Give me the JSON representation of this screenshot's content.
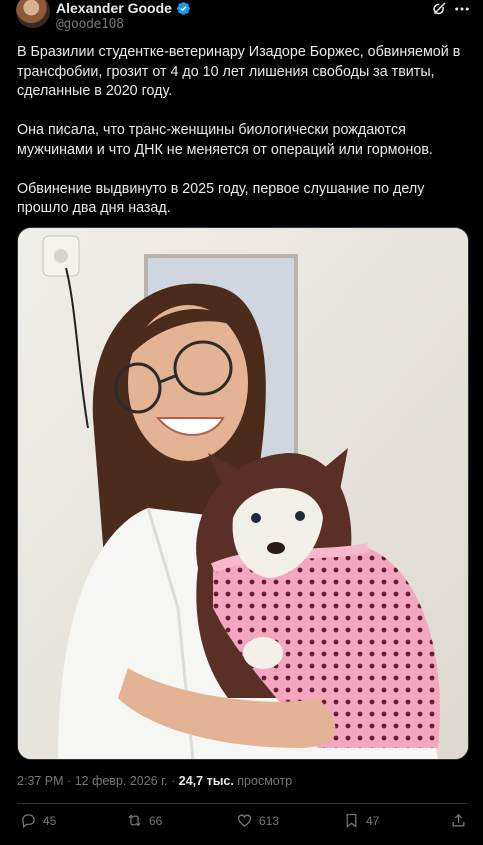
{
  "author": {
    "name": "Alexander Goode",
    "handle": "@goode108"
  },
  "tweet": {
    "paragraphs": [
      "В Бразилии студентке-ветеринару Изадоре Боржес, обвиняемой в трансфобии, грозит от 4 до 10 лет лишения свободы за твиты, сделанные в 2020 году.",
      "Она писала, что транс-женщины биологически рождаются мужчинами и что ДНК не меняется от операций или гормонов.",
      "Обвинение выдвинуто в 2025 году, первое слушание по делу прошло два дня назад."
    ]
  },
  "meta": {
    "time": "2:37 PM",
    "date": "12 февр. 2026 г.",
    "views_count": "24,7 тыс.",
    "views_label": "просмотр"
  },
  "actions": {
    "replies": "45",
    "reposts": "66",
    "likes": "613",
    "bookmarks": "47"
  },
  "colors": {
    "background": "#000000",
    "text": "#e7e9ea",
    "secondary": "#71767b",
    "verified": "#1d9bf0"
  }
}
